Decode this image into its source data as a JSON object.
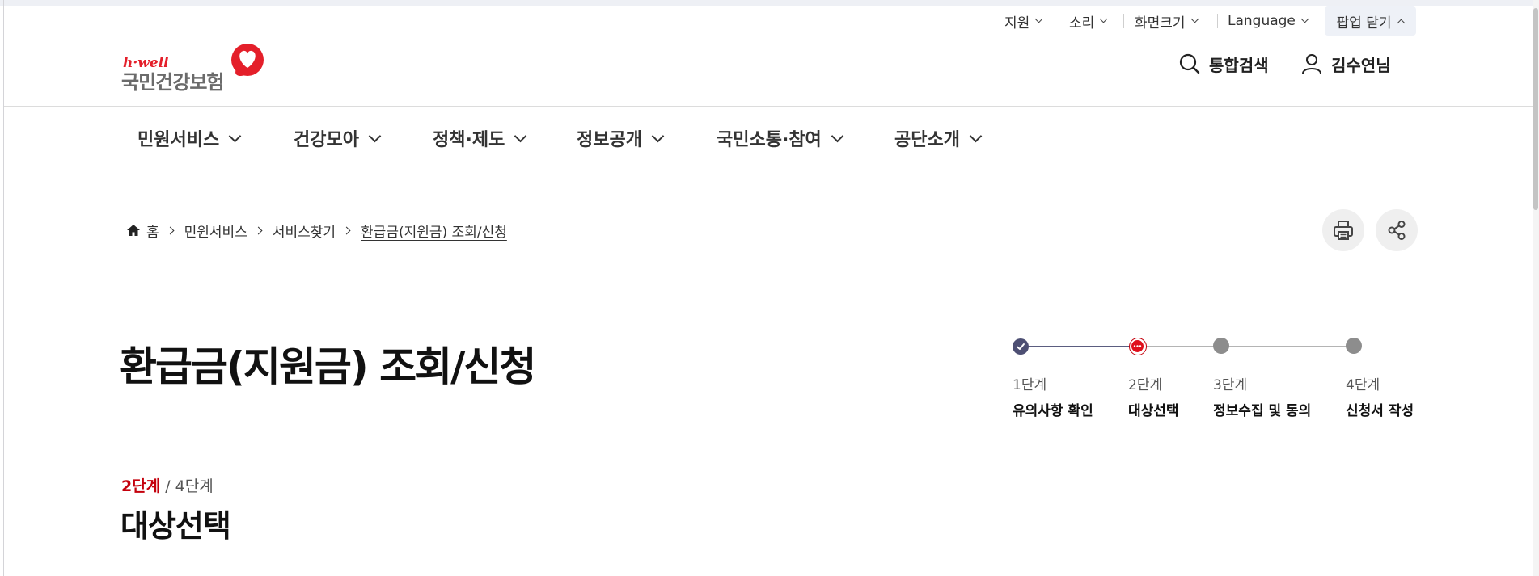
{
  "utility": {
    "support": "지원",
    "sound": "소리",
    "font_size": "화면크기",
    "language": "Language",
    "popup_close": "팝업 닫기"
  },
  "logo": {
    "tagline": "h·well",
    "name": "국민건강보험"
  },
  "header": {
    "search_label": "통합검색",
    "user_name": "김수연님"
  },
  "gnb": {
    "items": [
      "민원서비스",
      "건강모아",
      "정책·제도",
      "정보공개",
      "국민소통·참여",
      "공단소개"
    ]
  },
  "breadcrumb": {
    "home": "홈",
    "items": [
      "민원서비스",
      "서비스찾기",
      "환급금(지원금) 조회/신청"
    ]
  },
  "page": {
    "title": "환급금(지원금) 조회/신청"
  },
  "stepper": {
    "steps": [
      {
        "num": "1단계",
        "name": "유의사항 확인",
        "status": "done"
      },
      {
        "num": "2단계",
        "name": "대상선택",
        "status": "current"
      },
      {
        "num": "3단계",
        "name": "정보수집 및 동의",
        "status": "pending"
      },
      {
        "num": "4단계",
        "name": "신청서 작성",
        "status": "pending"
      }
    ]
  },
  "section": {
    "current_step": "2단계",
    "total_step": "/ 4단계",
    "title": "대상선택"
  },
  "colors": {
    "accent_red": "#c4000c",
    "logo_red": "#e41f2a",
    "done_navy": "#4d4f73",
    "pending_gray": "#8d8d8d"
  }
}
